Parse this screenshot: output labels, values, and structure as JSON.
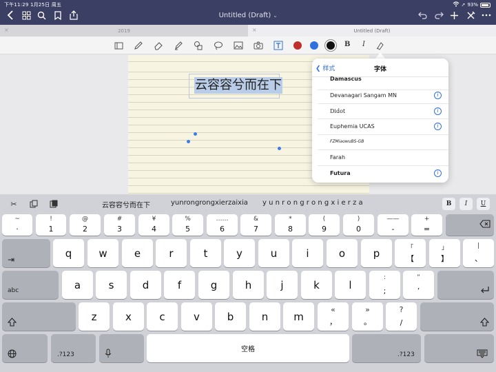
{
  "status": {
    "time_date": "下午11:29   1月25日 周五",
    "battery": "93%"
  },
  "nav": {
    "title": "Untitled (Draft)"
  },
  "tabs": [
    {
      "label": "2019"
    },
    {
      "label": "Untitled (Draft)"
    }
  ],
  "toolbar": {
    "colors": {
      "red": "#c0302a",
      "blue": "#2f6fe0",
      "black": "#111111"
    },
    "bold": "B",
    "italic": "I"
  },
  "canvas": {
    "text": "云容容兮而在下"
  },
  "popover": {
    "back": "样式",
    "title": "字体",
    "fonts": [
      {
        "name": "Damascus",
        "info": false
      },
      {
        "name": "Devanagari Sangam MN",
        "info": true
      },
      {
        "name": "Didot",
        "info": true
      },
      {
        "name": "Euphemia  UCAS",
        "info": true
      },
      {
        "name": "FZMiaowuBS-GB",
        "info": false
      },
      {
        "name": "Farah",
        "info": false
      },
      {
        "name": "Futura",
        "info": true
      }
    ]
  },
  "keyboard": {
    "suggestions": [
      "云容容兮而在下",
      "yunrongrongxierzaixia",
      "y u n r o n g r o n g x i e r z a"
    ],
    "format": {
      "bold": "B",
      "italic": "I",
      "underline": "U"
    },
    "row1": [
      {
        "sub": "~",
        "main": "·"
      },
      {
        "sub": "!",
        "main": "1"
      },
      {
        "sub": "@",
        "main": "2"
      },
      {
        "sub": "#",
        "main": "3"
      },
      {
        "sub": "¥",
        "main": "4"
      },
      {
        "sub": "%",
        "main": "5"
      },
      {
        "sub": "……",
        "main": "6"
      },
      {
        "sub": "&",
        "main": "7"
      },
      {
        "sub": "*",
        "main": "8"
      },
      {
        "sub": "(",
        "main": "9"
      },
      {
        "sub": ")",
        "main": "0"
      },
      {
        "sub": "——",
        "main": "-"
      },
      {
        "sub": "+",
        "main": "="
      }
    ],
    "row2": [
      "q",
      "w",
      "e",
      "r",
      "t",
      "y",
      "u",
      "i",
      "o",
      "p"
    ],
    "row2_extra": [
      {
        "sub": "「",
        "main": "【"
      },
      {
        "sub": "」",
        "main": "】"
      },
      {
        "sub": "|",
        "main": "、"
      }
    ],
    "row3": [
      "a",
      "s",
      "d",
      "f",
      "g",
      "h",
      "j",
      "k",
      "l"
    ],
    "row3_extra": [
      {
        "sub": ":",
        "main": ";"
      },
      {
        "sub": "”",
        "main": "’"
      }
    ],
    "row4": [
      "z",
      "x",
      "c",
      "v",
      "b",
      "n",
      "m"
    ],
    "row4_extra": [
      {
        "sub": "«",
        "main": "，"
      },
      {
        "sub": "»",
        "main": "。"
      },
      {
        "sub": "?",
        "main": "/"
      }
    ],
    "abc": "abc",
    "num_left": ".?123",
    "num_right": ".?123",
    "space": "空格"
  }
}
